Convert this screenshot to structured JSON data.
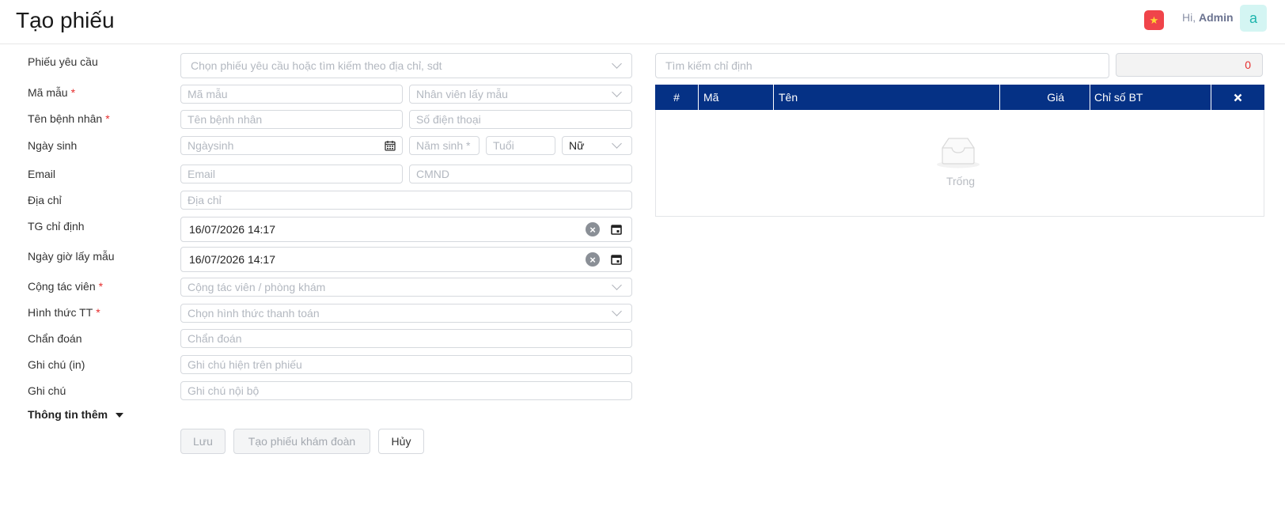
{
  "header": {
    "title": "Tạo phiếu",
    "greeting_prefix": "Hi,",
    "user_name": "Admin",
    "avatar_letter": "a",
    "flag_color": "#f0444a"
  },
  "form": {
    "labels": {
      "request_form": "Phiếu yêu cầu",
      "sample_code": "Mã mẫu",
      "patient_name": "Tên bệnh nhân",
      "birthdate": "Ngày sinh",
      "email": "Email",
      "address": "Địa chỉ",
      "assigned_time": "TG chỉ định",
      "sample_time": "Ngày giờ lấy mẫu",
      "collaborator": "Cộng tác viên",
      "payment_method": "Hình thức TT",
      "diagnosis": "Chẩn đoán",
      "note_print": "Ghi chú (in)",
      "note": "Ghi chú",
      "more_info": "Thông tin thêm",
      "required_mark": "*"
    },
    "placeholders": {
      "request_form": "Chọn phiếu yêu cầu hoặc tìm kiếm theo địa chỉ, sdt",
      "sample_code": "Mã mẫu",
      "sampler": "Nhân viên lấy mẫu",
      "patient_name": "Tên bệnh nhân",
      "phone": "Số điện thoại",
      "birthdate": "Ngàysinh",
      "birth_year": "Năm sinh *",
      "age": "Tuổi",
      "email": "Email",
      "id_card": "CMND",
      "address": "Địa chỉ",
      "collaborator": "Cộng tác viên / phòng khám",
      "payment_method": "Chọn hình thức thanh toán",
      "diagnosis": "Chẩn đoán",
      "note_print": "Ghi chú hiện trên phiếu",
      "note": "Ghi chú nội bộ"
    },
    "values": {
      "gender": "Nữ",
      "assigned_time": "16/07/2026 14:17",
      "sample_time": "16/07/2026 14:17"
    },
    "buttons": {
      "save": "Lưu",
      "create_group": "Tạo phiếu khám đoàn",
      "cancel": "Hủy"
    }
  },
  "right_panel": {
    "search_placeholder": "Tìm kiếm chỉ định",
    "total": "0",
    "columns": [
      "#",
      "Mã",
      "Tên",
      "Giá",
      "Chỉ số BT"
    ],
    "empty_text": "Trống",
    "header_color": "#053185"
  }
}
